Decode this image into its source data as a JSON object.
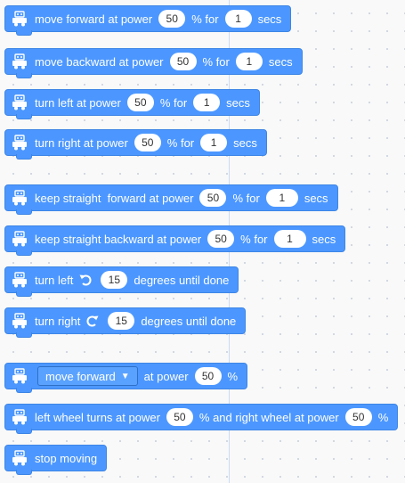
{
  "blocks": {
    "b1": {
      "t1": "move forward at power",
      "p1": "50",
      "t2": "% for",
      "p2": "1",
      "t3": "secs"
    },
    "b2": {
      "t1": "move backward at power",
      "p1": "50",
      "t2": "% for",
      "p2": "1",
      "t3": "secs"
    },
    "b3": {
      "t1": "turn left at power",
      "p1": "50",
      "t2": "% for",
      "p2": "1",
      "t3": "secs"
    },
    "b4": {
      "t1": "turn right at power",
      "p1": "50",
      "t2": "% for",
      "p2": "1",
      "t3": "secs"
    },
    "b5": {
      "t1": "keep straight  forward at power",
      "p1": "50",
      "t2": "% for",
      "p2": "1",
      "t3": "secs"
    },
    "b6": {
      "t1": "keep straight backward at power",
      "p1": "50",
      "t2": "% for",
      "p2": "1",
      "t3": "secs"
    },
    "b7": {
      "t1": "turn left",
      "p1": "15",
      "t2": "degrees until done"
    },
    "b8": {
      "t1": "turn right",
      "p1": "15",
      "t2": "degrees until done"
    },
    "b9": {
      "dropdown": "move forward",
      "t1": "at power",
      "p1": "50",
      "t2": "%"
    },
    "b10": {
      "t1": "left wheel turns at power",
      "p1": "50",
      "t2": "% and right wheel at power",
      "p2": "50",
      "t3": "%"
    },
    "b11": {
      "t1": "stop moving"
    }
  },
  "icons": {
    "block_icon": "robot-car-icon",
    "ccw": "rotate-counterclockwise-icon",
    "cw": "rotate-clockwise-icon",
    "dropdown_caret": "caret-down-icon"
  },
  "colors": {
    "block": "#4c97ff",
    "block_border": "#3d85e6",
    "canvas": "#f9f9f9"
  }
}
